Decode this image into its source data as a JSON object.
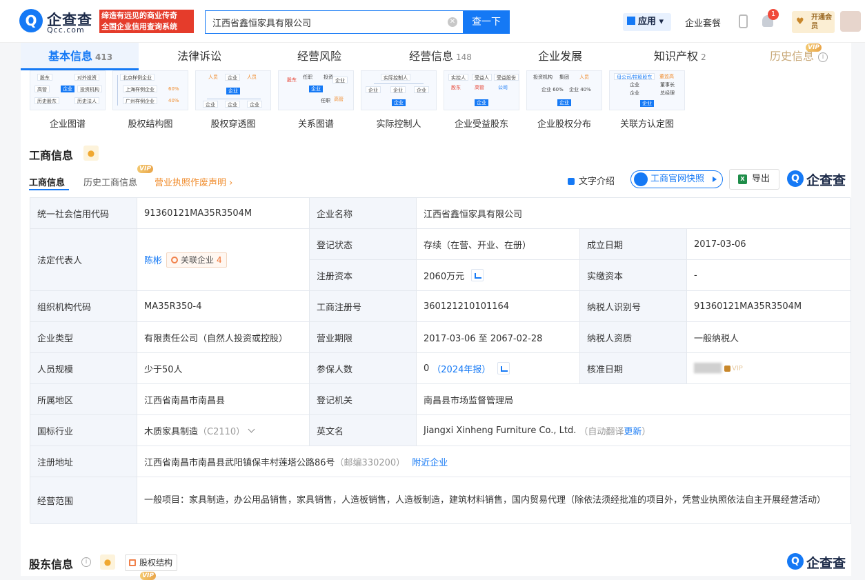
{
  "header": {
    "logo_text": "企查查",
    "logo_sub": "Qcc.com",
    "slogan_line1": "缔造有远见的商业传奇",
    "slogan_line2": "全国企业信用查询系统",
    "search_value": "江西省鑫恒家具有限公司",
    "search_button": "查一下",
    "apps_label": "应用",
    "package_label": "企业套餐",
    "notify_count": "1",
    "vip_open_label": "开通会员"
  },
  "tabs": [
    {
      "label": "基本信息",
      "count": "413"
    },
    {
      "label": "法律诉讼",
      "count": ""
    },
    {
      "label": "经营风险",
      "count": ""
    },
    {
      "label": "经营信息",
      "count": "148"
    },
    {
      "label": "企业发展",
      "count": ""
    },
    {
      "label": "知识产权",
      "count": "2"
    },
    {
      "label": "历史信息",
      "count": "",
      "vip": "VIP"
    }
  ],
  "graphs": [
    {
      "label": "企业图谱"
    },
    {
      "label": "股权结构图"
    },
    {
      "label": "股权穿透图"
    },
    {
      "label": "关系图谱"
    },
    {
      "label": "实际控制人"
    },
    {
      "label": "企业受益股东"
    },
    {
      "label": "企业股权分布"
    },
    {
      "label": "关联方认定图"
    }
  ],
  "graph_text": {
    "g1": [
      "股东",
      "对外投资",
      "高管",
      "企业",
      "投资机构",
      "历史股东",
      "历史法人"
    ],
    "g2": [
      "北京样例企业",
      "上海样例企业",
      "60%",
      "广州样例企业",
      "40%"
    ],
    "g3": [
      "人员",
      "企业",
      "人员",
      "企业",
      "企业",
      "企业",
      "企业"
    ],
    "g4": [
      "股东",
      "任职",
      "投资",
      "企业",
      "企业",
      "高管",
      "任职"
    ],
    "g5": [
      "实际控制人",
      "企业",
      "企业",
      "企业",
      "企业"
    ],
    "g6": [
      "实控人",
      "受益人",
      "受益股份",
      "股东",
      "高管",
      "公司",
      "企业"
    ],
    "g7": [
      "投资机构",
      "集团",
      "人员",
      "企业 60%",
      "企业 40%",
      "企业"
    ],
    "g8": [
      "母公司/控股股东",
      "董监高",
      "企业",
      "董事长",
      "企业",
      "总经理",
      "企业"
    ]
  },
  "section": {
    "title": "工商信息",
    "subtabs": [
      "工商信息",
      "历史工商信息",
      "营业执照作废声明"
    ],
    "subtab_vip": "VIP",
    "tool_text_intro": "文字介绍",
    "tool_snapshot": "工商官网快照",
    "tool_export": "导出",
    "brand": "企查查"
  },
  "biz": {
    "credit_code_label": "统一社会信用代码",
    "credit_code": "91360121MA35R3504M",
    "company_name_label": "企业名称",
    "company_name": "江西省鑫恒家具有限公司",
    "legal_rep_label": "法定代表人",
    "legal_rep": "陈彬",
    "related_label": "关联企业",
    "related_count": "4",
    "reg_status_label": "登记状态",
    "reg_status": "存续（在营、开业、在册）",
    "founded_label": "成立日期",
    "founded": "2017-03-06",
    "reg_capital_label": "注册资本",
    "reg_capital": "2060万元",
    "paid_capital_label": "实缴资本",
    "paid_capital": "-",
    "org_code_label": "组织机构代码",
    "org_code": "MA35R350-4",
    "biz_reg_no_label": "工商注册号",
    "biz_reg_no": "360121210101164",
    "taxpayer_id_label": "纳税人识别号",
    "taxpayer_id": "91360121MA35R3504M",
    "company_type_label": "企业类型",
    "company_type": "有限责任公司（自然人投资或控股）",
    "term_label": "营业期限",
    "term": "2017-03-06 至 2067-02-28",
    "taxpayer_qual_label": "纳税人资质",
    "taxpayer_qual": "一般纳税人",
    "staff_size_label": "人员规模",
    "staff_size": "少于50人",
    "insured_label": "参保人数",
    "insured": "0",
    "insured_year": "（2024年报）",
    "approval_date_label": "核准日期",
    "approval_date_masked": "VIP",
    "region_label": "所属地区",
    "region": "江西省南昌市南昌县",
    "authority_label": "登记机关",
    "authority": "南昌县市场监督管理局",
    "industry_label": "国标行业",
    "industry": "木质家具制造",
    "industry_code": "（C2110）",
    "en_name_label": "英文名",
    "en_name": "Jiangxi Xinheng Furniture Co., Ltd.",
    "en_auto": "（自动翻译",
    "en_update": "更新",
    "en_close": "）",
    "address_label": "注册地址",
    "address": "江西省南昌市南昌县武阳镇保丰村莲塔公路86号",
    "postcode": "（邮编330200）",
    "nearby": "附近企业",
    "scope_label": "经营范围",
    "scope": "一般项目：家具制造，办公用品销售，家具销售，人造板销售，人造板制造，建筑材料销售，国内贸易代理（除依法须经批准的项目外，凭营业执照依法自主开展经营活动）"
  },
  "shareholders": {
    "title": "股东信息",
    "struct_label": "股权结构",
    "vip": "VIP",
    "brand": "企查查"
  },
  "colors": {
    "accent": "#1579f5",
    "brand_red": "#e53c2b",
    "orange": "#f08b2b",
    "label_bg": "#f3f6fb"
  }
}
